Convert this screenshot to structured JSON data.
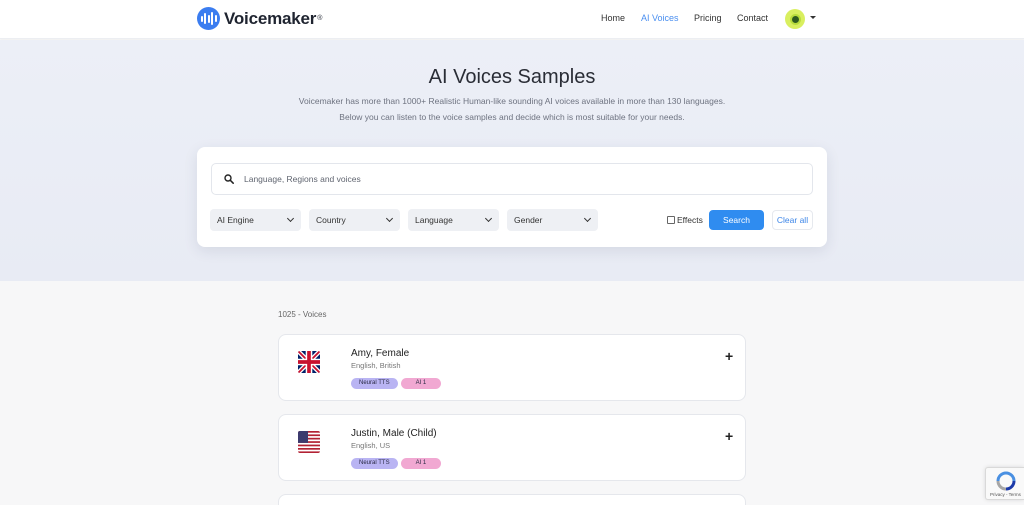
{
  "header": {
    "brand": "Voicemaker",
    "brand_mark": "®",
    "nav": [
      {
        "label": "Home",
        "active": false
      },
      {
        "label": "AI Voices",
        "active": true
      },
      {
        "label": "Pricing",
        "active": false
      },
      {
        "label": "Contact",
        "active": false
      }
    ],
    "accent_color": "#4a8ff0"
  },
  "hero": {
    "title": "AI Voices Samples",
    "subtitle_line1": "Voicemaker has more than 1000+ Realistic Human-like sounding AI voices available in more than 130 languages.",
    "subtitle_line2": "Below you can listen to the voice samples and decide which is most suitable for your needs."
  },
  "search": {
    "placeholder": "Language, Regions and voices",
    "value": "",
    "filters": [
      {
        "label": "AI Engine"
      },
      {
        "label": "Country"
      },
      {
        "label": "Language"
      },
      {
        "label": "Gender"
      }
    ],
    "effects_label": "Effects",
    "effects_checked": false,
    "search_button": "Search",
    "clear_button": "Clear all",
    "button_color": "#2f8cf0"
  },
  "results": {
    "count_text": "1025 - Voices",
    "voices": [
      {
        "name": "Amy, Female",
        "language": "English, British",
        "flag": "uk-flag-icon",
        "tags": [
          "Neural TTS",
          "AI 1"
        ]
      },
      {
        "name": "Justin, Male (Child)",
        "language": "English, US",
        "flag": "us-flag-icon",
        "tags": [
          "Neural TTS",
          "AI 1"
        ]
      }
    ],
    "expand_symbol": "+"
  },
  "recaptcha": {
    "text": "Privacy - Terms"
  }
}
